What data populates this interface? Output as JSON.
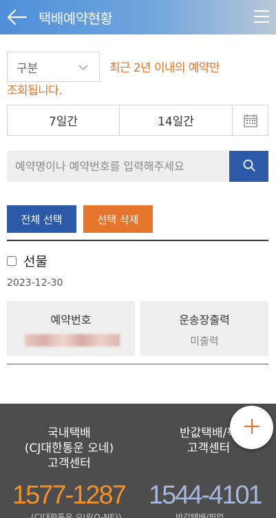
{
  "header": {
    "title": "택배예약현황"
  },
  "filter": {
    "category_label": "구분",
    "notice_line1": "최근 2년 이내의 예약만",
    "notice_line2": "조회됩니다.",
    "period_7": "7일간",
    "period_14": "14일간"
  },
  "search": {
    "placeholder": "예약명이나 예약번호를 입력해주세요"
  },
  "actions": {
    "select_all": "전체 선택",
    "delete_selected": "선택 삭제"
  },
  "reservation": {
    "title": "선물",
    "date": "2023-12-30",
    "number_label": "예약번호",
    "print_label": "운송장출력",
    "print_status": "미출력"
  },
  "footer": {
    "domestic": {
      "line1": "국내택배",
      "line2": "(CJ대한통운 오네)",
      "line3": "고객센터",
      "phone": "1577-1287",
      "subtext": "(CJ대한통운 오네(O-NE))"
    },
    "halfprice": {
      "line1": "반값택배/픽",
      "line2": "고객센터",
      "phone": "1544-4101",
      "subtext": "반값택배/픽업"
    }
  },
  "colors": {
    "primary_blue": "#2c5aa8",
    "accent_orange": "#e5742c",
    "footer_bg": "#4d4d4d"
  }
}
